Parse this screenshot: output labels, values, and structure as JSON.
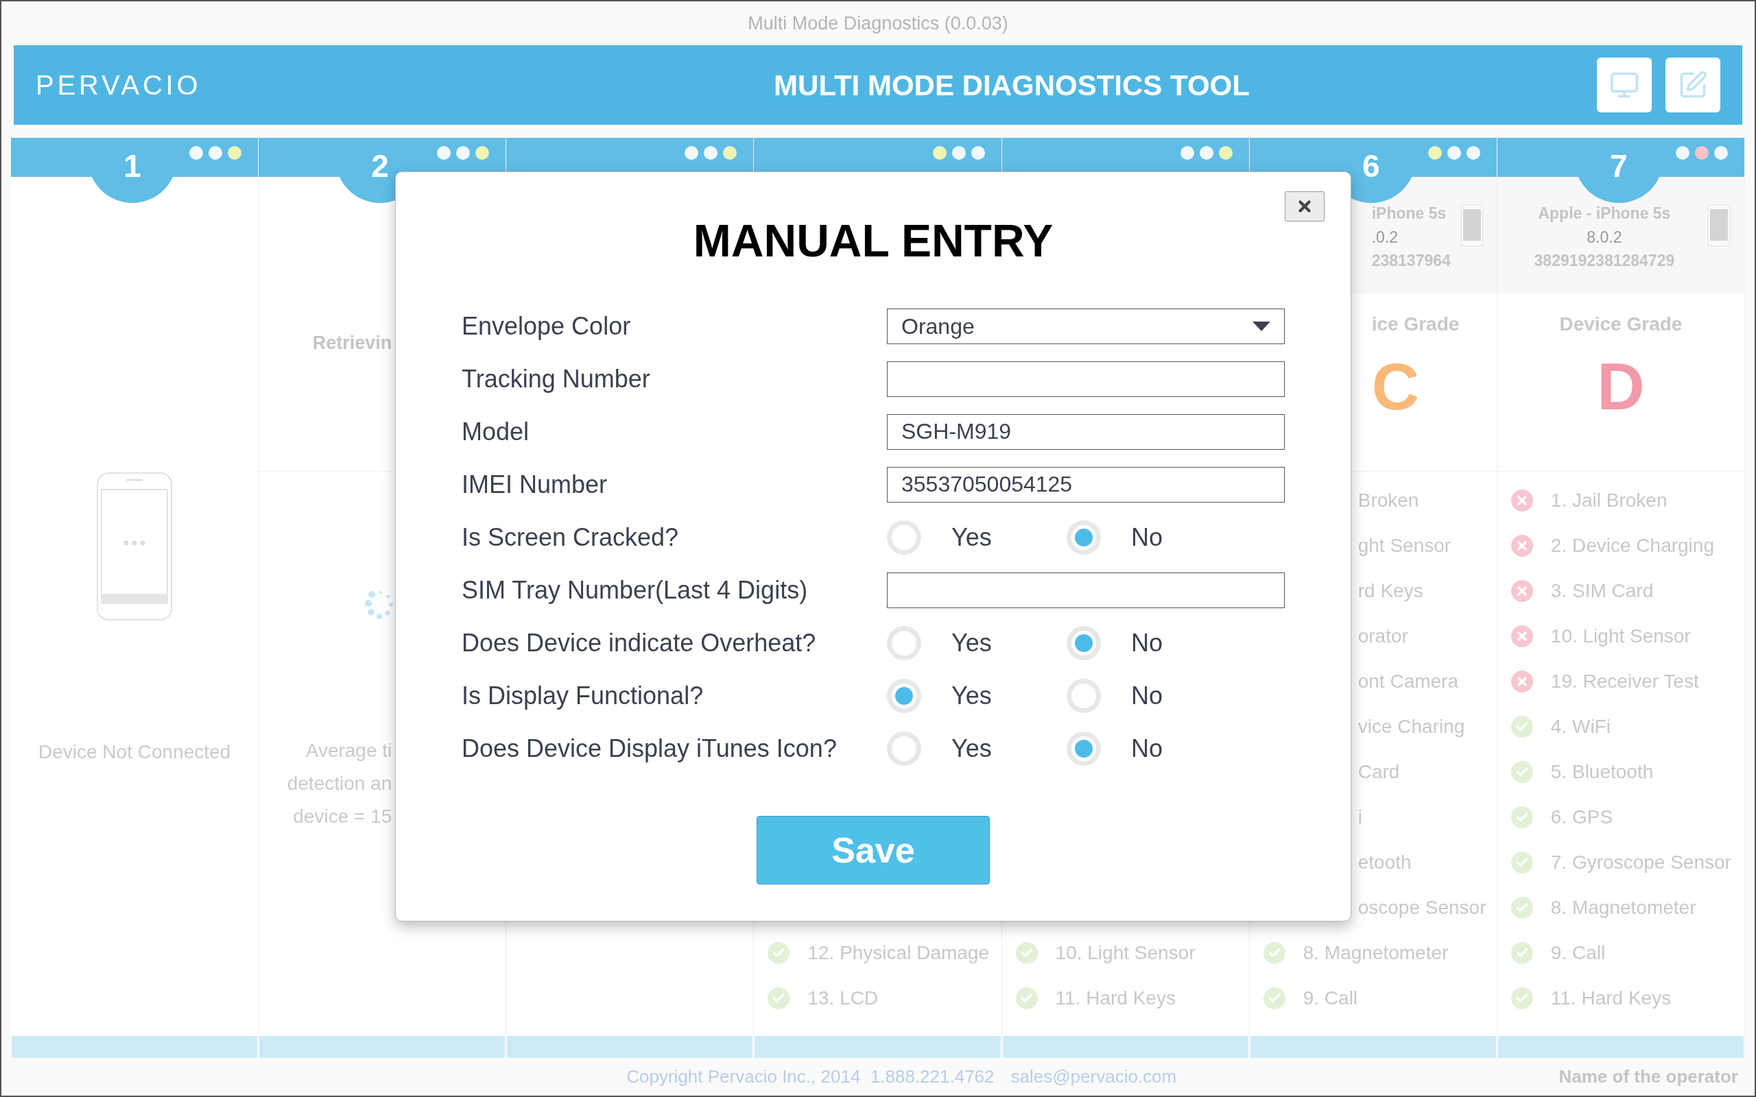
{
  "window": {
    "title": "Multi Mode Diagnostics (0.0.03)"
  },
  "header": {
    "logo": "PERVACIO",
    "title": "MULTI MODE DIAGNOSTICS TOOL"
  },
  "columns": [
    {
      "kind": "empty",
      "number": "1",
      "dots": [
        {
          "color": "#f2f9fc"
        },
        {
          "color": "#f2f9fc"
        },
        {
          "color": "#eef4b4"
        }
      ],
      "status": "Device Not Connected"
    },
    {
      "kind": "detecting",
      "number": "2",
      "dots": [
        {
          "color": "#f2f9fc"
        },
        {
          "color": "#f2f9fc"
        },
        {
          "color": "#eef4b4"
        }
      ],
      "status": "Retrievin",
      "notes": [
        "Average ti",
        "detection an",
        "device = 15"
      ]
    },
    {
      "kind": "covered",
      "dots": [
        {
          "color": "#f2f9fc"
        },
        {
          "color": "#f2f9fc"
        },
        {
          "color": "#eef4b4"
        }
      ]
    },
    {
      "kind": "covered",
      "dots": [
        {
          "color": "#eef4b4"
        },
        {
          "color": "#f2f9fc"
        },
        {
          "color": "#f2f9fc"
        }
      ],
      "tests": [
        {
          "kind": "pass",
          "label": "12. Physical Damage"
        },
        {
          "kind": "pass",
          "label": "13. LCD"
        }
      ]
    },
    {
      "kind": "covered",
      "dots": [
        {
          "color": "#f2f9fc"
        },
        {
          "color": "#f2f9fc"
        },
        {
          "color": "#eef4b4"
        }
      ],
      "tests": [
        {
          "kind": "pass",
          "label": "10. Light Sensor"
        },
        {
          "kind": "pass",
          "label": "11. Hard Keys"
        }
      ]
    },
    {
      "kind": "partial",
      "number": "6",
      "dots": [
        {
          "color": "#eef4b4"
        },
        {
          "color": "#f2f9fc"
        },
        {
          "color": "#f2f9fc"
        }
      ],
      "device": {
        "name": "iPhone 5s",
        "version": ".0.2",
        "serial": "238137964"
      },
      "grade_title": "ice Grade",
      "grade": "C",
      "color": "#f9b978",
      "tests": [
        {
          "kind": "cut",
          "label": "Broken"
        },
        {
          "kind": "cut",
          "label": "ght Sensor"
        },
        {
          "kind": "cut",
          "label": "rd Keys"
        },
        {
          "kind": "cut",
          "label": "orator"
        },
        {
          "kind": "cut",
          "label": "ont Camera"
        },
        {
          "kind": "cut",
          "label": "vice Charing"
        },
        {
          "kind": "cut",
          "label": "Card"
        },
        {
          "kind": "cut",
          "label": "i"
        },
        {
          "kind": "cut",
          "label": "etooth"
        },
        {
          "kind": "cut",
          "label": "oscope Sensor"
        },
        {
          "kind": "pass",
          "label": "8. Magnetometer"
        },
        {
          "kind": "pass",
          "label": "9. Call"
        }
      ]
    },
    {
      "kind": "full",
      "number": "7",
      "dots": [
        {
          "color": "#f2f9fc"
        },
        {
          "color": "#f7c3cb"
        },
        {
          "color": "#f2f9fc"
        }
      ],
      "device": {
        "name": "Apple - iPhone 5s",
        "version": "8.0.2",
        "serial": "3829192381284729"
      },
      "grade_title": "Device Grade",
      "grade": "D",
      "color": "#f29aaa",
      "tests": [
        {
          "kind": "fail",
          "label": "1. Jail Broken"
        },
        {
          "kind": "fail",
          "label": "2. Device Charging"
        },
        {
          "kind": "fail",
          "label": "3. SIM Card"
        },
        {
          "kind": "fail",
          "label": "10. Light Sensor"
        },
        {
          "kind": "fail",
          "label": "19. Receiver Test"
        },
        {
          "kind": "pass",
          "label": "4. WiFi"
        },
        {
          "kind": "pass",
          "label": "5. Bluetooth"
        },
        {
          "kind": "pass",
          "label": "6. GPS"
        },
        {
          "kind": "pass",
          "label": "7. Gyroscope Sensor"
        },
        {
          "kind": "pass",
          "label": "8. Magnetometer"
        },
        {
          "kind": "pass",
          "label": "9. Call"
        },
        {
          "kind": "pass",
          "label": "11. Hard Keys"
        }
      ]
    }
  ],
  "footer": {
    "copyright": "Copyright Pervacio Inc., 2014  1.888.221.4762",
    "email": "sales@pervacio.com",
    "operator": "Name of the operator"
  },
  "dialog": {
    "title": "MANUAL ENTRY",
    "fields": [
      {
        "kind": "select",
        "label": "Envelope Color",
        "value": "Orange"
      },
      {
        "kind": "text",
        "label": "Tracking Number"
      },
      {
        "kind": "text",
        "label": "Model",
        "value": "SGH-M919"
      },
      {
        "kind": "text",
        "label": "IMEI Number",
        "value": "35537050054125"
      },
      {
        "kind": "radio",
        "label": "Is Screen Cracked?",
        "options": [
          {
            "label": "Yes",
            "selected": false
          },
          {
            "label": "No",
            "selected": true
          }
        ]
      },
      {
        "kind": "text",
        "label": "SIM Tray Number(Last 4 Digits)"
      },
      {
        "kind": "radio",
        "label": "Does Device indicate Overheat?",
        "options": [
          {
            "label": "Yes",
            "selected": false
          },
          {
            "label": "No",
            "selected": true
          }
        ]
      },
      {
        "kind": "radio",
        "label": "Is Display Functional?",
        "options": [
          {
            "label": "Yes",
            "selected": true
          },
          {
            "label": "No",
            "selected": false
          }
        ]
      },
      {
        "kind": "radio",
        "label": "Does Device Display iTunes Icon?",
        "options": [
          {
            "label": "Yes",
            "selected": false
          },
          {
            "label": "No",
            "selected": true
          }
        ]
      }
    ],
    "save": "Save"
  }
}
